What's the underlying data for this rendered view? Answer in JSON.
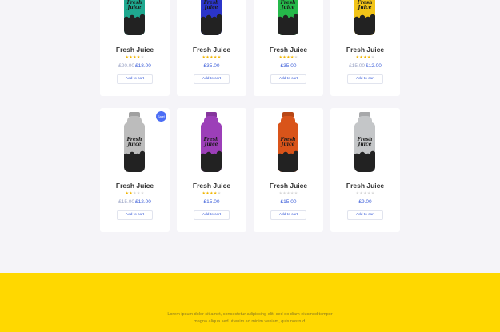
{
  "products_top": [
    {
      "title": "Fresh Juice",
      "rating": 4,
      "old_price": "£20.00",
      "price": "£18.00",
      "button": "Add to cart",
      "color": "#1fa88f",
      "sale": false,
      "brand": "Fresh Juice"
    },
    {
      "title": "Fresh Juice",
      "rating": 5,
      "old_price": "",
      "price": "£35.00",
      "button": "Add to cart",
      "color": "#2b35c9",
      "sale": false,
      "brand": "Fresh Juice"
    },
    {
      "title": "Fresh Juice",
      "rating": 4,
      "old_price": "",
      "price": "£35.00",
      "button": "Add to cart",
      "color": "#25b84a",
      "sale": false,
      "brand": "Fresh Juice"
    },
    {
      "title": "Fresh Juice",
      "rating": 4,
      "old_price": "£15.00",
      "price": "£12.00",
      "button": "Add to cart",
      "color": "#f2c418",
      "sale": false,
      "brand": "Fresh Juice"
    }
  ],
  "products_bottom": [
    {
      "title": "Fresh Juice",
      "rating": 2,
      "old_price": "£15.00",
      "price": "£12.00",
      "button": "Add to cart",
      "color": "#bcbcbc",
      "sale": true,
      "sale_label": "Sale!",
      "brand": "Fresh Juice"
    },
    {
      "title": "Fresh Juice",
      "rating": 4,
      "old_price": "",
      "price": "£15.00",
      "button": "Add to cart",
      "color": "#9c3fb8",
      "sale": false,
      "brand": "Fresh Juice"
    },
    {
      "title": "Fresh Juice",
      "rating": 0,
      "old_price": "",
      "price": "£15.00",
      "button": "Add to cart",
      "color": "#d9541a",
      "sale": false,
      "brand": "Fresh Juice"
    },
    {
      "title": "Fresh Juice",
      "rating": 0,
      "old_price": "",
      "price": "£9.00",
      "button": "Add to cart",
      "color": "#c4c6c8",
      "sale": false,
      "brand": "Fresh Juice"
    }
  ],
  "footer": {
    "line1": "Lorem ipsum dolor sit amet, consectetur adipiscing elit, sed do diam eiusmod tempor",
    "line2": "magna aliqua sed ut enim ad minim veniam, quis nostrud.",
    "background": "#ffd800"
  }
}
